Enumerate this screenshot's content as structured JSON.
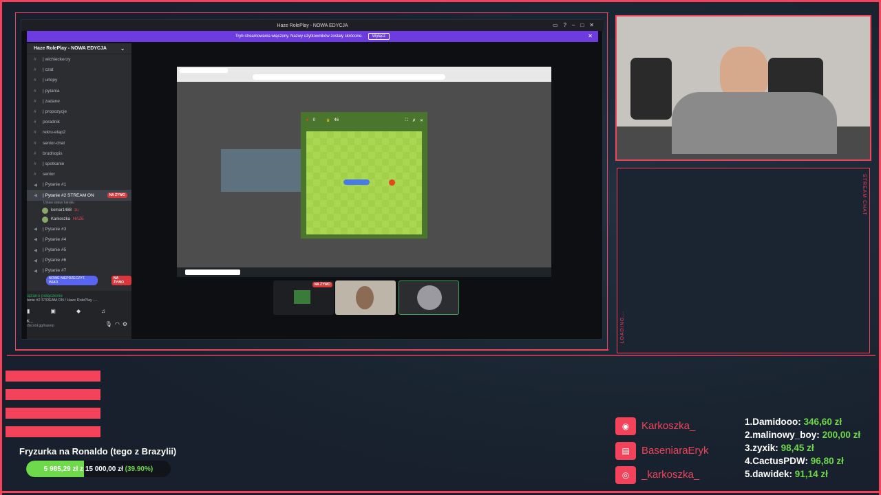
{
  "discord": {
    "window_title": "Haze RolePlay - NOWA EDYCJA",
    "banner_text": "Tryb streamowania włączony. Nazwy użytkowników zostały skrócone.",
    "banner_button": "Wyłącz",
    "server_name": "Haze RolePlay - NOWA EDYCJA",
    "channels": [
      {
        "label": "| wichieckerzy"
      },
      {
        "label": "| czat"
      },
      {
        "label": "| urlopy"
      },
      {
        "label": "| pytania"
      },
      {
        "label": "| zadane"
      },
      {
        "label": "| propozycje"
      },
      {
        "label": "poradnik"
      },
      {
        "label": "rekru-etap2"
      },
      {
        "label": "senior-chat"
      },
      {
        "label": "brudnopis"
      },
      {
        "label": "| spotkanie"
      },
      {
        "label": "senior"
      },
      {
        "label": "| Pytanie #1"
      }
    ],
    "active_channel": "| Pytanie #2 STREAM ON",
    "active_channel_status": "Ustaw status kanału",
    "live_badge": "NA ŻYWO",
    "members": [
      {
        "name": "komar1488",
        "tag": "zu"
      },
      {
        "name": "Karkoszka",
        "tag": "HAZE"
      }
    ],
    "channels_after": [
      {
        "label": "| Pytanie #3"
      },
      {
        "label": "| Pytanie #4"
      },
      {
        "label": "| Pytanie #5"
      },
      {
        "label": "| Pytanie #6"
      },
      {
        "label": "| Pytanie #7"
      }
    ],
    "new_unread": "NOWE NIEPRZECZYT. WIAD.",
    "voice_connected": "iązano połączenie",
    "voice_channel": "tanie #2 STREAM ON / Haze RolePlay -...",
    "user_short": "K...",
    "user_status": "discord.gg/hazerp"
  },
  "snake": {
    "apples": "0",
    "trophy": "46"
  },
  "tile_live_badge": "NA ŻYWO",
  "chat": {
    "side_label": "STREAM CHAT",
    "loading_label": "LOADING..."
  },
  "goal": {
    "title": "Fryzurka na Ronaldo (tego z Brazylii)",
    "current": "5 985,29 zł",
    "sep": "z",
    "target": "15 000,00 zł",
    "percent_text": "(39.90%)",
    "progress": 0.399
  },
  "socials": [
    {
      "icon": "discord-icon",
      "text": "Karkoszka_"
    },
    {
      "icon": "twitch-icon",
      "text": "BaseniaraEryk"
    },
    {
      "icon": "instagram-icon",
      "text": "_karkoszka_"
    }
  ],
  "donors": [
    {
      "rank": "1.",
      "name": "Damidooo:",
      "amount": "346,60 zł"
    },
    {
      "rank": "2.",
      "name": "malinowy_boy:",
      "amount": "200,00 zł"
    },
    {
      "rank": "3.",
      "name": "zyxik:",
      "amount": "98,45 zł"
    },
    {
      "rank": "4.",
      "name": "CactusPDW:",
      "amount": "96,80 zł"
    },
    {
      "rank": "5.",
      "name": "dawidek:",
      "amount": "91,14 zł"
    }
  ],
  "colors": {
    "accent": "#f2435a",
    "goal_fill": "#6fd94c",
    "discord_purple": "#6d3ce0"
  }
}
